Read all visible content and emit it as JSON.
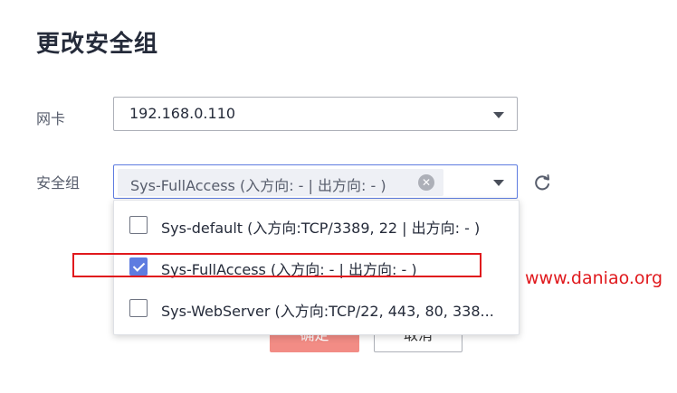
{
  "dialog": {
    "title": "更改安全组",
    "nic": {
      "label": "网卡",
      "value": "192.168.0.110"
    },
    "security_group": {
      "label": "安全组",
      "selected_tag": "Sys-FullAccess (入方向: - | 出方向: - )",
      "options": [
        {
          "label": "Sys-default (入方向:TCP/3389, 22 | 出方向: - )",
          "checked": false
        },
        {
          "label": "Sys-FullAccess (入方向: -  | 出方向: - )",
          "checked": true
        },
        {
          "label": "Sys-WebServer (入方向:TCP/22, 443, 80, 338...",
          "checked": false
        }
      ]
    },
    "buttons": {
      "confirm": "确定",
      "cancel": "取消"
    }
  },
  "watermark": "www.daniao.org",
  "colors": {
    "accent": "#5e7ce0",
    "annotation": "#e0191d",
    "confirm_button": "#f28c85"
  },
  "icons": {
    "refresh": "refresh-icon",
    "tag_close": "close-circle-icon",
    "caret": "caret-down-icon"
  }
}
